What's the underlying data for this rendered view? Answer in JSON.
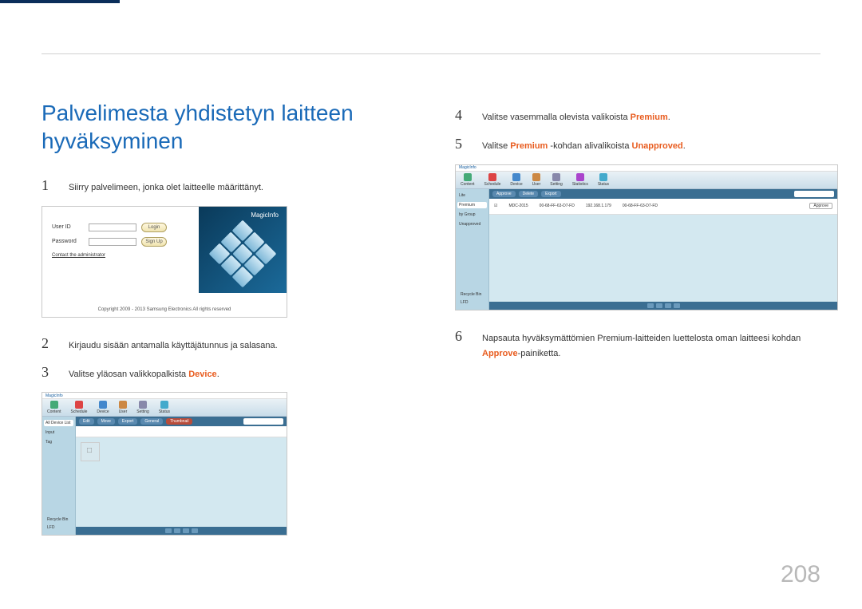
{
  "page_number": "208",
  "section_title": "Palvelimesta yhdistetyn laitteen hyväksyminen",
  "steps": {
    "s1": {
      "num": "1",
      "text": "Siirry palvelimeen, jonka olet laitteelle määrittänyt."
    },
    "s2": {
      "num": "2",
      "text": "Kirjaudu sisään antamalla käyttäjätunnus ja salasana."
    },
    "s3": {
      "num": "3",
      "prefix": "Valitse yläosan valikkopalkista ",
      "hl": "Device",
      "suffix": "."
    },
    "s4": {
      "num": "4",
      "prefix": "Valitse vasemmalla olevista valikoista ",
      "hl": "Premium",
      "suffix": "."
    },
    "s5": {
      "num": "5",
      "p1": "Valitse ",
      "hl1": "Premium",
      "p2": " -kohdan alivalikoista ",
      "hl2": "Unapproved",
      "suffix": "."
    },
    "s6": {
      "num": "6",
      "p1": "Napsauta hyväksymättömien Premium-laitteiden luettelosta oman laitteesi kohdan ",
      "hl": "Approve",
      "p2": "-painiketta."
    }
  },
  "login_mock": {
    "user_label": "User ID",
    "pass_label": "Password",
    "login_btn": "Login",
    "signup_btn": "Sign Up",
    "contact": "Contact the administrator",
    "copyright": "Copyright 2009 - 2013 Samsung Electronics All rights reserved",
    "graphic_label": "MagicInfo"
  },
  "app_mock": {
    "logo": "MagicInfo",
    "tabs": [
      "Content",
      "Schedule",
      "Device",
      "User",
      "Setting",
      "Statistics",
      "Status"
    ],
    "side_a": [
      "All Device List",
      "Input",
      "Tag"
    ],
    "side_b": [
      "Lite",
      "Premium",
      "by Group",
      "Unapproved"
    ],
    "side_bottom": [
      "Recycle Bin",
      "LFD"
    ],
    "toolbar": [
      "Edit",
      "Move",
      "Export",
      "General",
      "Thumbnail"
    ],
    "row": {
      "chk": "☑",
      "name": "MDC-2015",
      "id": "00-68-FF-63-D7-FD",
      "ip": "192.168.1.179",
      "mac": "00-68-FF-63-D7-FD",
      "model": "",
      "status": "Approve"
    }
  }
}
